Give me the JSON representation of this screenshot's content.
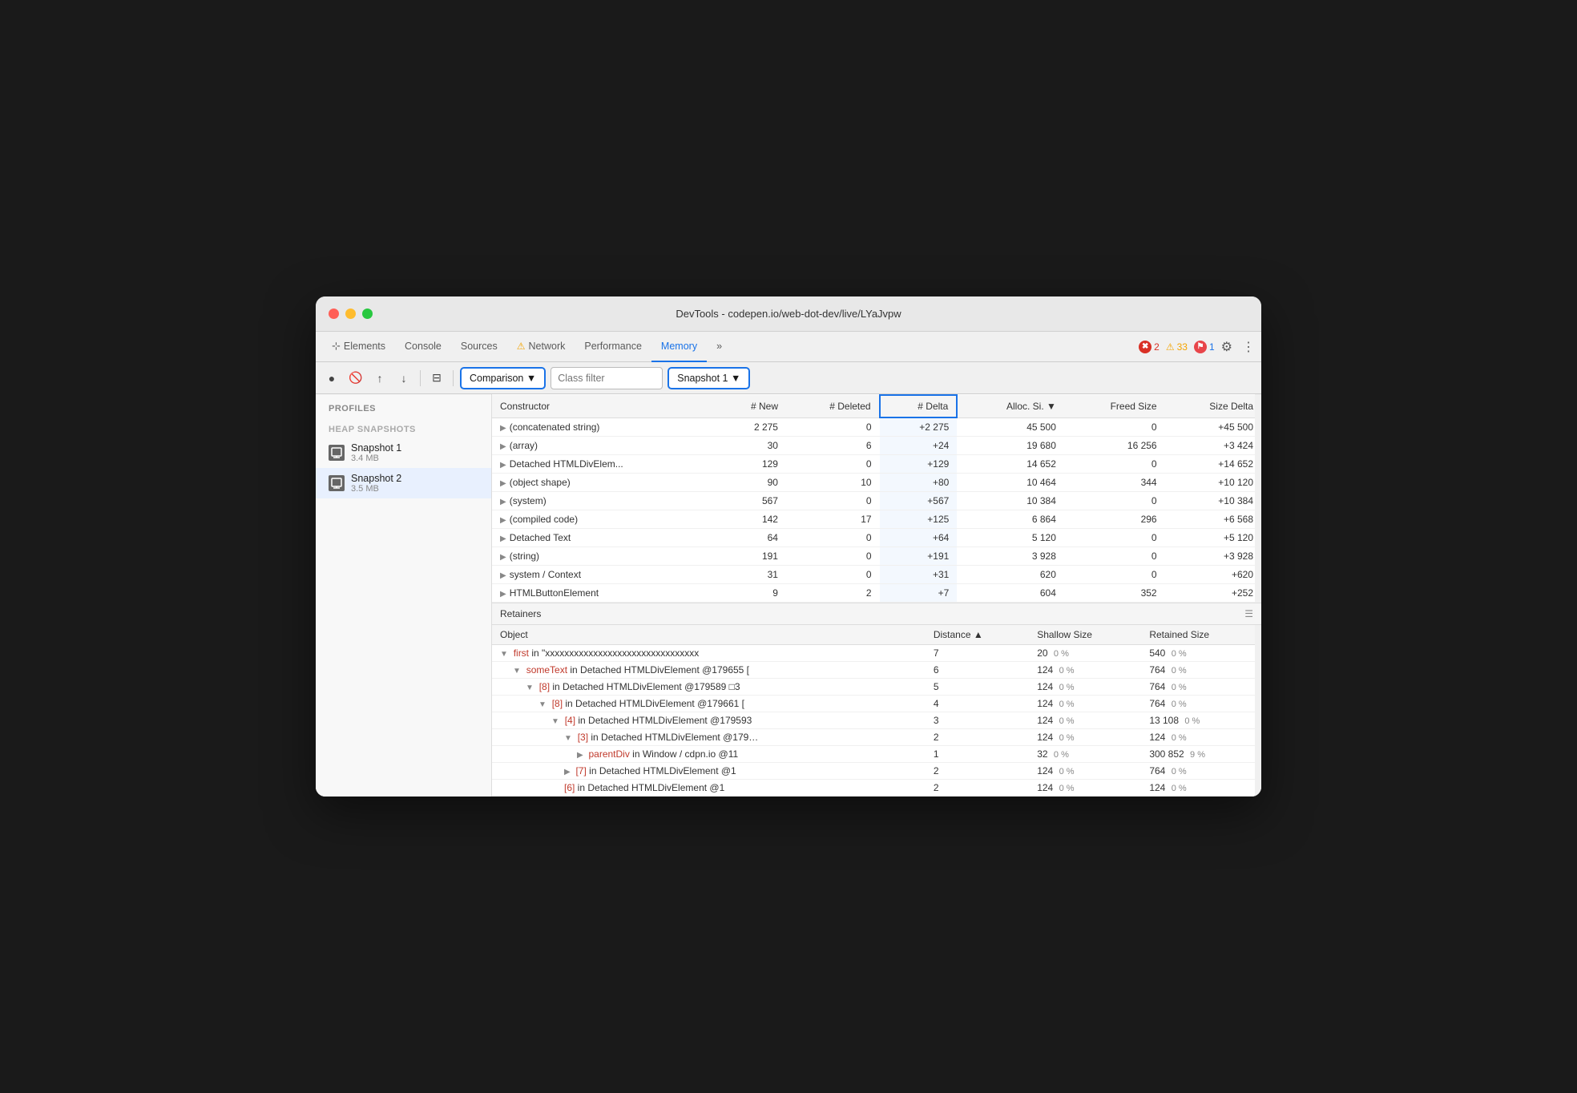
{
  "window": {
    "title": "DevTools - codepen.io/web-dot-dev/live/LYaJvpw"
  },
  "tabs": [
    {
      "label": "Elements",
      "active": false
    },
    {
      "label": "Console",
      "active": false
    },
    {
      "label": "Sources",
      "active": false
    },
    {
      "label": "⚠ Network",
      "active": false,
      "warn": true
    },
    {
      "label": "Performance",
      "active": false
    },
    {
      "label": "Memory",
      "active": true
    },
    {
      "label": "»",
      "active": false
    }
  ],
  "badges": {
    "error": "2",
    "warn": "33",
    "info": "1"
  },
  "toolbar": {
    "comparison_label": "Comparison ▼",
    "class_filter_placeholder": "Class filter",
    "snapshot_label": "Snapshot 1 ▼"
  },
  "table": {
    "headers": [
      "Constructor",
      "# New",
      "# Deleted",
      "# Delta",
      "Alloc. Si. ▼",
      "Freed Size",
      "Size Delta"
    ],
    "rows": [
      {
        "constructor": "(concatenated string)",
        "new": "2 275",
        "deleted": "0",
        "delta": "+2 275",
        "alloc": "45 500",
        "freed": "0",
        "size_delta": "+45 500"
      },
      {
        "constructor": "(array)",
        "new": "30",
        "deleted": "6",
        "delta": "+24",
        "alloc": "19 680",
        "freed": "16 256",
        "size_delta": "+3 424"
      },
      {
        "constructor": "Detached HTMLDivElem...",
        "new": "129",
        "deleted": "0",
        "delta": "+129",
        "alloc": "14 652",
        "freed": "0",
        "size_delta": "+14 652"
      },
      {
        "constructor": "(object shape)",
        "new": "90",
        "deleted": "10",
        "delta": "+80",
        "alloc": "10 464",
        "freed": "344",
        "size_delta": "+10 120"
      },
      {
        "constructor": "(system)",
        "new": "567",
        "deleted": "0",
        "delta": "+567",
        "alloc": "10 384",
        "freed": "0",
        "size_delta": "+10 384"
      },
      {
        "constructor": "(compiled code)",
        "new": "142",
        "deleted": "17",
        "delta": "+125",
        "alloc": "6 864",
        "freed": "296",
        "size_delta": "+6 568"
      },
      {
        "constructor": "Detached Text",
        "new": "64",
        "deleted": "0",
        "delta": "+64",
        "alloc": "5 120",
        "freed": "0",
        "size_delta": "+5 120"
      },
      {
        "constructor": "(string)",
        "new": "191",
        "deleted": "0",
        "delta": "+191",
        "alloc": "3 928",
        "freed": "0",
        "size_delta": "+3 928"
      },
      {
        "constructor": "system / Context",
        "new": "31",
        "deleted": "0",
        "delta": "+31",
        "alloc": "620",
        "freed": "0",
        "size_delta": "+620"
      },
      {
        "constructor": "HTMLButtonElement",
        "new": "9",
        "deleted": "2",
        "delta": "+7",
        "alloc": "604",
        "freed": "352",
        "size_delta": "+252"
      }
    ]
  },
  "retainers": {
    "title": "Retainers",
    "headers": [
      "Object",
      "Distance ▲",
      "Shallow Size",
      "Retained Size"
    ],
    "rows": [
      {
        "indent": 0,
        "object": "▼ first in \"xxxxxxxxxxxxxxxxxxxxxxxxxxxxxxxx",
        "key": "first",
        "rest": " in \"xxxxxxxxxxxxxxxxxxxxxxxxxxxxxxxx",
        "distance": "7",
        "shallow": "20",
        "shallow_pct": "0 %",
        "retained": "540",
        "retained_pct": "0 %"
      },
      {
        "indent": 1,
        "object": "▼ someText in Detached HTMLDivElement @179655 [",
        "key": "someText",
        "rest": " in Detached HTMLDivElement @179655 [",
        "distance": "6",
        "shallow": "124",
        "shallow_pct": "0 %",
        "retained": "764",
        "retained_pct": "0 %"
      },
      {
        "indent": 2,
        "object": "▼ [8] in Detached HTMLDivElement @179589 □3",
        "key": "[8]",
        "rest": " in Detached HTMLDivElement @179589 □3",
        "distance": "5",
        "shallow": "124",
        "shallow_pct": "0 %",
        "retained": "764",
        "retained_pct": "0 %"
      },
      {
        "indent": 3,
        "object": "▼ [8] in Detached HTMLDivElement @179661 [",
        "key": "[8]",
        "rest": " in Detached HTMLDivElement @179661 [",
        "distance": "4",
        "shallow": "124",
        "shallow_pct": "0 %",
        "retained": "764",
        "retained_pct": "0 %"
      },
      {
        "indent": 4,
        "object": "▼ [4] in Detached HTMLDivElement @179593",
        "key": "[4]",
        "rest": " in Detached HTMLDivElement @179593",
        "distance": "3",
        "shallow": "124",
        "shallow_pct": "0 %",
        "retained": "13 108",
        "retained_pct": "0 %"
      },
      {
        "indent": 5,
        "object": "▼ [3] in Detached HTMLDivElement @179…",
        "key": "[3]",
        "rest": " in Detached HTMLDivElement @179…",
        "distance": "2",
        "shallow": "124",
        "shallow_pct": "0 %",
        "retained": "124",
        "retained_pct": "0 %"
      },
      {
        "indent": 6,
        "object": "▶ parentDiv in Window / cdpn.io @11",
        "key": "parentDiv",
        "rest": " in Window / cdpn.io @11",
        "distance": "1",
        "shallow": "32",
        "shallow_pct": "0 %",
        "retained": "300 852",
        "retained_pct": "9 %"
      },
      {
        "indent": 5,
        "object": "▶ [7] in Detached HTMLDivElement @1",
        "key": "[7]",
        "rest": " in Detached HTMLDivElement @1",
        "distance": "2",
        "shallow": "124",
        "shallow_pct": "0 %",
        "retained": "764",
        "retained_pct": "0 %"
      },
      {
        "indent": 5,
        "object": "[6] in Detached HTMLDivElement @1",
        "key": "[6]",
        "rest": " in Detached HTMLDivElement @1",
        "distance": "2",
        "shallow": "124",
        "shallow_pct": "0 %",
        "retained": "124",
        "retained_pct": "0 %"
      }
    ]
  },
  "sidebar": {
    "profiles_label": "Profiles",
    "heap_snapshots_label": "HEAP SNAPSHOTS",
    "snapshots": [
      {
        "name": "Snapshot 1",
        "size": "3.4 MB"
      },
      {
        "name": "Snapshot 2",
        "size": "3.5 MB",
        "active": true
      }
    ]
  }
}
